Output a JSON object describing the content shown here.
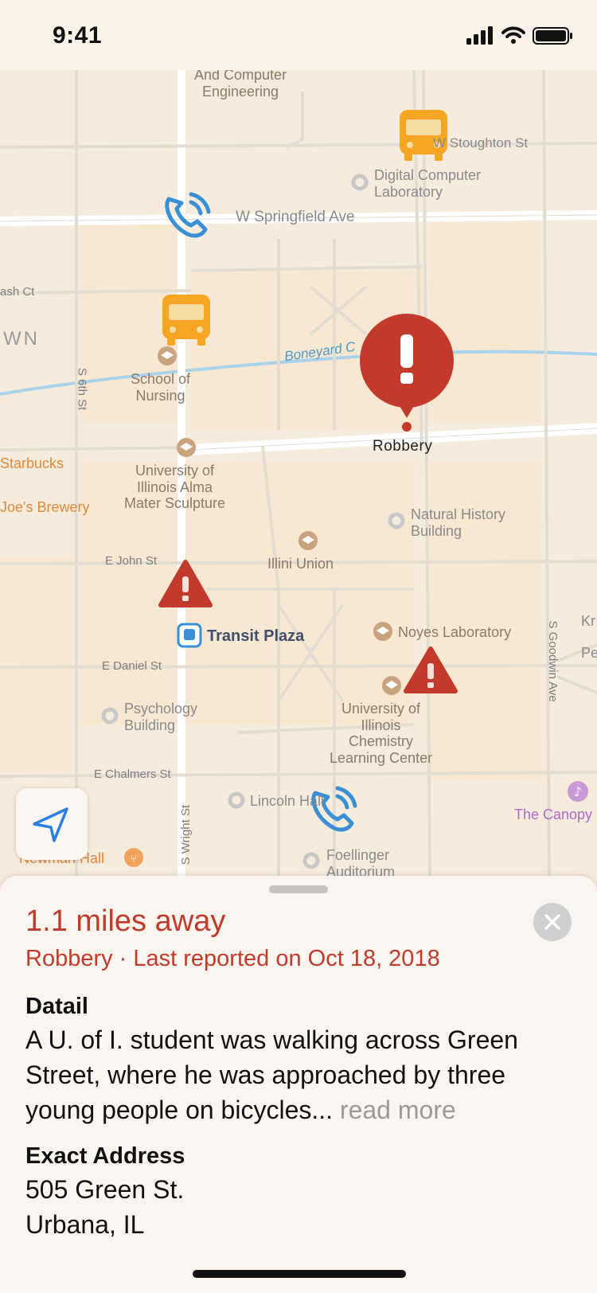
{
  "status_bar": {
    "time": "9:41"
  },
  "map": {
    "labels": {
      "ece": "And Computer\nEngineering",
      "stoughton": "W Stoughton St",
      "dcl": "Digital Computer\nLaboratory",
      "springfield": "W Springfield Ave",
      "nash": "ash Ct",
      "own": "WN",
      "boneyard": "Boneyard C",
      "sixth": "S 6th St",
      "nursing": "School of\nNursing",
      "starbucks": "Starbucks",
      "joes": "Joe's Brewery",
      "alma": "University of\nIllinois Alma\nMater Sculpture",
      "nhb": "Natural History\nBuilding",
      "illini": "Illini Union",
      "john": "E John St",
      "transit": "Transit Plaza",
      "noyes": "Noyes Laboratory",
      "goodwin": "S Goodwin Ave",
      "kr": "Kr",
      "pe": "Pe",
      "daniel": "E Daniel St",
      "psych": "Psychology\nBuilding",
      "chem": "University of\nIllinois\nChemistry\nLearning Center",
      "chalmers": "E Chalmers St",
      "lincoln": "Lincoln Hall",
      "canopy": "The Canopy",
      "wright": "S Wright St",
      "newman": "Newman Hall",
      "foellinger": "Foellinger\nAuditorium",
      "robbery_pin": "Robbery"
    },
    "colors": {
      "incident": "#c23a2c",
      "bus": "#f5a623",
      "phone": "#3a8fd6",
      "water": "#a8d3ea"
    }
  },
  "sheet": {
    "distance": "1.1 miles away",
    "subtitle": "Robbery · Last reported on Oct 18, 2018",
    "detail_heading": "Datail",
    "detail_text": "A U. of I. student was walking across Green Street, where he was approached by three young people on bicycles...",
    "read_more": " read more",
    "address_heading": "Exact Address",
    "address_line1": "505 Green St.",
    "address_line2": "Urbana, IL"
  }
}
